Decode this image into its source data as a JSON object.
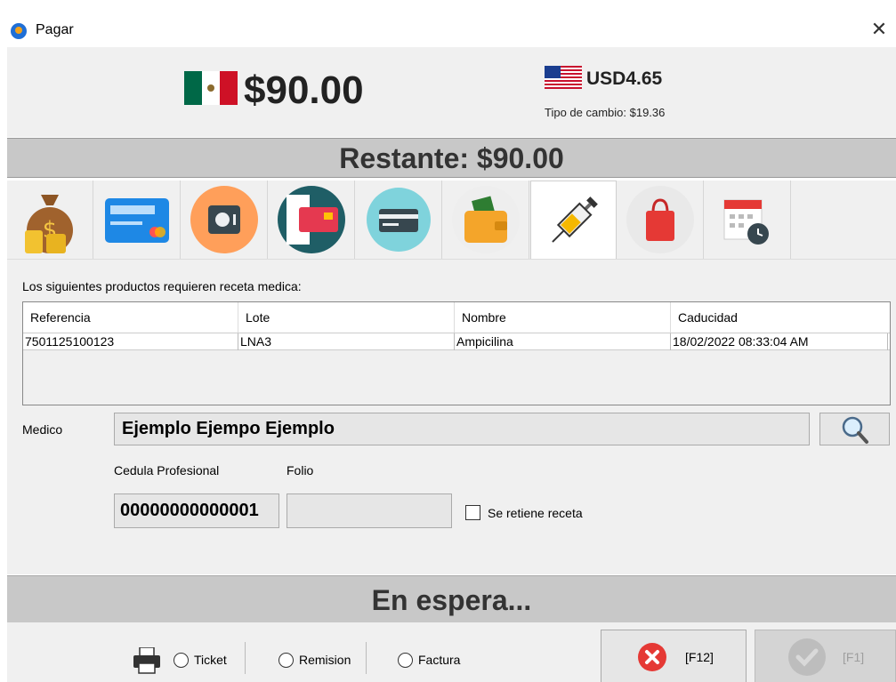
{
  "window": {
    "title": "Pagar",
    "close_glyph": "✕"
  },
  "totals": {
    "mxn_amount": "$90.00",
    "usd_amount": "USD4.65",
    "exchange_rate": "Tipo de cambio: $19.36",
    "remaining": "Restante: $90.00"
  },
  "payment_tabs": [
    {
      "icon": "money-bag-coins-icon",
      "active": false
    },
    {
      "icon": "credit-card-icon",
      "active": false
    },
    {
      "icon": "safe-icon",
      "active": false
    },
    {
      "icon": "voucher-card-icon",
      "active": false
    },
    {
      "icon": "cheque-icon",
      "active": false
    },
    {
      "icon": "wallet-icon",
      "active": false
    },
    {
      "icon": "syringe-icon",
      "active": true
    },
    {
      "icon": "shopping-bag-icon",
      "active": false
    },
    {
      "icon": "calendar-clock-icon",
      "active": false
    }
  ],
  "prescription": {
    "heading": "Los siguientes productos requieren receta medica:",
    "columns": [
      "Referencia",
      "Lote",
      "Nombre",
      "Caducidad"
    ],
    "rows": [
      [
        "7501125100123",
        "LNA3",
        "Ampicilina",
        "18/02/2022 08:33:04 AM"
      ]
    ],
    "medico_label": "Medico",
    "medico_value": "Ejemplo Ejempo Ejemplo",
    "cedula_label": "Cedula Profesional",
    "folio_label": "Folio",
    "cedula_value": "00000000000001",
    "folio_value": "",
    "retain_label": "Se retiene receta",
    "retain_checked": false
  },
  "status": {
    "text": "En espera..."
  },
  "footer": {
    "print_options": [
      "Ticket",
      "Remision",
      "Factura"
    ],
    "cancel_label": "[F12]",
    "accept_label": "[F1]"
  },
  "colors": {
    "mx_green": "#006847",
    "mx_red": "#ce1126",
    "cancel_red": "#e53935",
    "accept_disabled": "#bdbdbd"
  }
}
